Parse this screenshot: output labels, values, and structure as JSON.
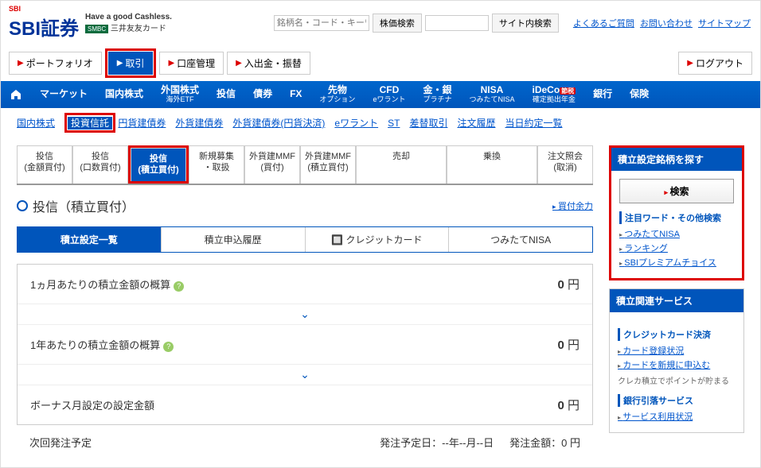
{
  "header": {
    "logo_small": "SBI",
    "logo_main": "SBI証券",
    "cashless": "Have a good Cashless.",
    "smbc_badge": "SMBC",
    "smbc_text": "三井友友カード",
    "search1_placeholder": "銘柄名・コード・キーワ",
    "search1_btn": "株価検索",
    "search2_btn": "サイト内検索",
    "top_links": [
      "よくあるご質問",
      "お問い合わせ",
      "サイトマップ"
    ]
  },
  "action_bar": {
    "portfolio": "ポートフォリオ",
    "trade": "取引",
    "account": "口座管理",
    "deposit": "入出金・振替",
    "logout": "ログアウト"
  },
  "main_nav": [
    {
      "label": "マーケット"
    },
    {
      "label": "国内株式"
    },
    {
      "label": "外国株式",
      "sub": "海外ETF"
    },
    {
      "label": "投信"
    },
    {
      "label": "債券"
    },
    {
      "label": "FX"
    },
    {
      "label": "先物",
      "sub": "オプション"
    },
    {
      "label": "CFD",
      "sub": "eワラント"
    },
    {
      "label": "金・銀",
      "sub": "プラチナ"
    },
    {
      "label": "NISA",
      "sub": "つみたてNISA"
    },
    {
      "label": "iDeCo",
      "sub": "確定拠出年金",
      "badge": "節税"
    },
    {
      "label": "銀行"
    },
    {
      "label": "保険"
    }
  ],
  "sub_nav": [
    "国内株式",
    "投資信託",
    "円貨建債券",
    "外貨建債券",
    "外貨建債券(円貨決済)",
    "eワラント",
    "ST",
    "差替取引",
    "注文履歴",
    "当日約定一覧"
  ],
  "sub_nav_active": 1,
  "tabs": [
    {
      "l1": "投信",
      "l2": "(金額買付)"
    },
    {
      "l1": "投信",
      "l2": "(口数買付)"
    },
    {
      "l1": "投信",
      "l2": "(積立買付)"
    },
    {
      "l1": "新規募集",
      "l2": "・取扱"
    },
    {
      "l1": "外貨建MMF",
      "l2": "(買付)"
    },
    {
      "l1": "外貨建MMF",
      "l2": "(積立買付)"
    },
    {
      "l1": "売却",
      "l2": ""
    },
    {
      "l1": "乗換",
      "l2": ""
    },
    {
      "l1": "注文照会",
      "l2": "(取消)"
    }
  ],
  "tabs_active": 2,
  "page_title": "投信（積立買付）",
  "buy_power": "買付余力",
  "inner_tabs": [
    "積立設定一覧",
    "積立申込履歴",
    "クレジットカード",
    "つみたてNISA"
  ],
  "inner_tabs_active": 0,
  "summary": {
    "monthly_label": "1ヵ月あたりの積立金額の概算",
    "monthly_val": "0",
    "yearly_label": "1年あたりの積立金額の概算",
    "yearly_val": "0",
    "bonus_label": "ボーナス月設定の設定金額",
    "bonus_val": "0",
    "unit": "円"
  },
  "next": {
    "label": "次回発注予定",
    "date_label": "発注予定日：",
    "date_val": "--年--月--日",
    "amt_label": "発注金額：",
    "amt_val": "0 円"
  },
  "side_search": {
    "head": "積立設定銘柄を探す",
    "btn": "検索",
    "subhead": "注目ワード・その他検索",
    "links": [
      "つみたてNISA",
      "ランキング",
      "SBIプレミアムチョイス"
    ]
  },
  "side_service": {
    "head": "積立関連サービス",
    "sub1": "クレジットカード決済",
    "links1": [
      "カード登録状況",
      "カードを新規に申込む"
    ],
    "note": "クレカ積立でポイントが貯まる",
    "sub2": "銀行引落サービス",
    "links2": [
      "サービス利用状況"
    ]
  }
}
